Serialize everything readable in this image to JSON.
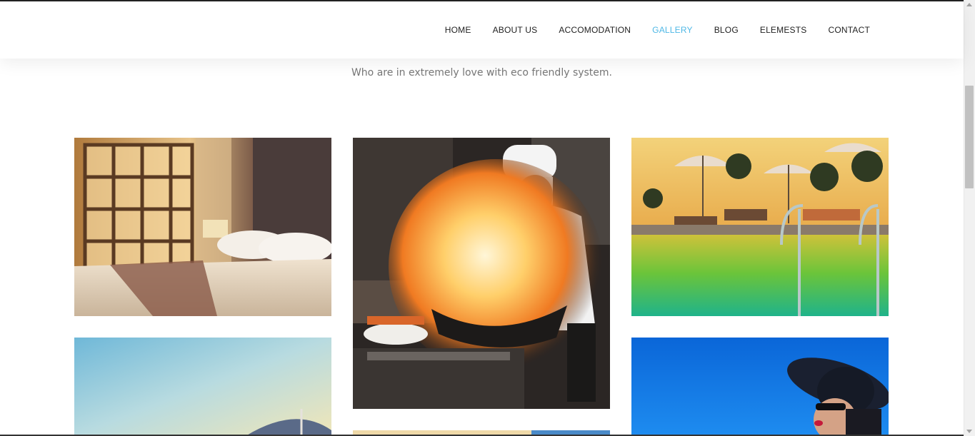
{
  "nav": {
    "items": [
      {
        "label": "HOME",
        "active": false
      },
      {
        "label": "ABOUT US",
        "active": false
      },
      {
        "label": "ACCOMODATION",
        "active": false
      },
      {
        "label": "GALLERY",
        "active": true
      },
      {
        "label": "BLOG",
        "active": false
      },
      {
        "label": "ELEMESTS",
        "active": false
      },
      {
        "label": "CONTACT",
        "active": false
      }
    ],
    "active_color": "#4fb8e6"
  },
  "section": {
    "subtitle": "Who are in extremely love with eco friendly system."
  },
  "gallery": {
    "images": [
      {
        "subject": "hotel-bedroom"
      },
      {
        "subject": "chef-flambe-kitchen"
      },
      {
        "subject": "poolside-loungers-palms"
      },
      {
        "subject": "beach-umbrella-sky"
      },
      {
        "subject": "beach-sand"
      },
      {
        "subject": "woman-sun-hat-blue-sky"
      }
    ]
  }
}
